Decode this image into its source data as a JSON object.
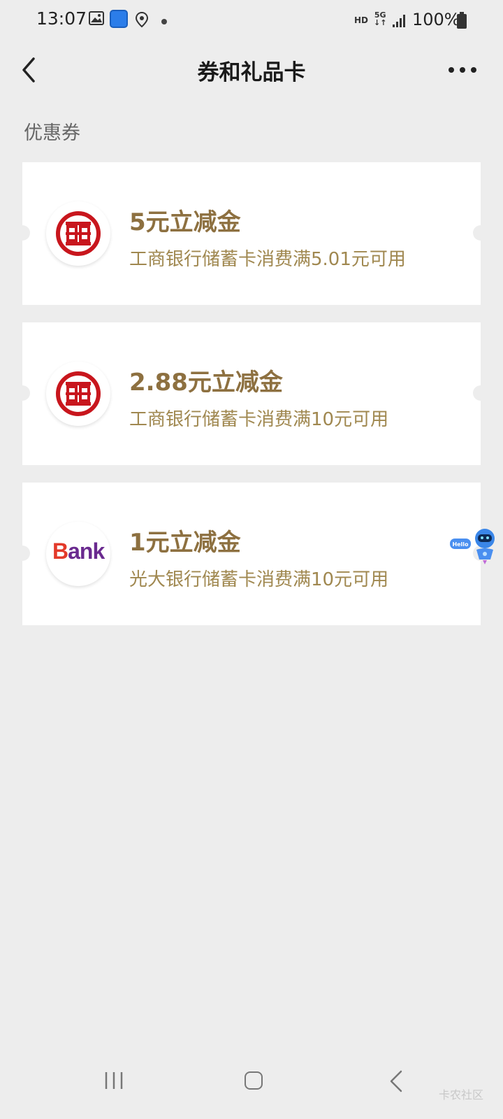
{
  "status_bar": {
    "time": "13:07",
    "hd": "HD",
    "network": "5G",
    "battery": "100%"
  },
  "nav": {
    "title": "券和礼品卡",
    "back_icon": "chevron-left-icon",
    "more_icon": "more-dots-icon"
  },
  "section": {
    "title": "优惠券"
  },
  "coupons": [
    {
      "title": "5元立减金",
      "desc": "工商银行储蓄卡消费满5.01元可用",
      "logo": "icbc-logo"
    },
    {
      "title": "2.88元立减金",
      "desc": "工商银行储蓄卡消费满10元可用",
      "logo": "icbc-logo"
    },
    {
      "title": "1元立减金",
      "desc": "光大银行储蓄卡消费满10元可用",
      "logo": "bank-logo",
      "logo_text_first": "B",
      "logo_text_rest": "ank"
    }
  ],
  "robot": {
    "label": "Hello"
  },
  "watermark": "卡农社区",
  "colors": {
    "background": "#ededed",
    "coupon_title": "#8d7040",
    "coupon_desc": "#a08850",
    "icbc_red": "#c8161d"
  }
}
